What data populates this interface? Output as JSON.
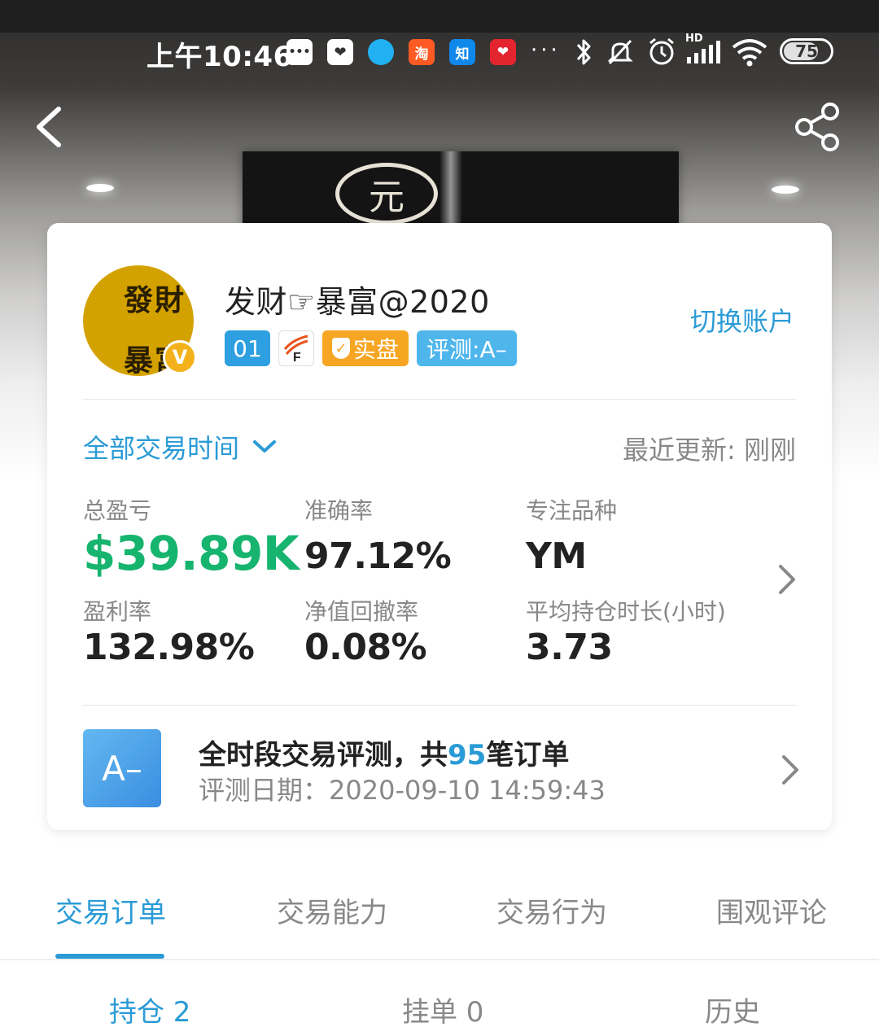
{
  "status_bar": {
    "time": "上午10:46",
    "app_icons": [
      {
        "name": "message-icon",
        "text": "•••",
        "color": "#ffffff"
      },
      {
        "name": "app-heart-icon",
        "text": "❤",
        "color": "#ffffff"
      },
      {
        "name": "app-bird-icon",
        "text": "",
        "color": "#21b1f3"
      },
      {
        "name": "taobao-icon",
        "text": "淘",
        "color": "#ff5a23"
      },
      {
        "name": "zhihu-icon",
        "text": "知",
        "color": "#0f88eb"
      },
      {
        "name": "app-red-heart-icon",
        "text": "❤",
        "color": "#e4252f"
      }
    ],
    "network": "HD",
    "battery": "75",
    "battery_level": 0.75
  },
  "profile": {
    "avatar_line1": "發財",
    "avatar_line2": "暴富",
    "verified_mark": "V",
    "username": "发财☞暴富@2020",
    "badges": {
      "number": "01",
      "f_logo": "F",
      "real_label": "实盘",
      "rating": "评测:A–"
    },
    "switch_account": "切换账户"
  },
  "filter": {
    "period": "全部交易时间",
    "updated": "最近更新: 刚刚"
  },
  "stats": {
    "total_pnl_label": "总盈亏",
    "total_pnl_value": "$39.89K",
    "accuracy_label": "准确率",
    "accuracy_value": "97.12%",
    "focus_label": "专注品种",
    "focus_value": "YM",
    "profit_rate_label": "盈利率",
    "profit_rate_value": "132.98%",
    "drawdown_label": "净值回撤率",
    "drawdown_value": "0.08%",
    "hold_time_label": "平均持仓时长(小时)",
    "hold_time_value": "3.73"
  },
  "evaluation": {
    "grade": "A–",
    "title_prefix": "全时段交易评测，共",
    "order_count": "95",
    "title_suffix": "笔订单",
    "date": "评测日期：2020-09-10 14:59:43"
  },
  "tabs": [
    "交易订单",
    "交易能力",
    "交易行为",
    "围观评论"
  ],
  "subtabs": [
    "持仓 2",
    "挂单 0",
    "历史"
  ],
  "colors": {
    "accent": "#2a9bd6",
    "profit_green": "#16b46e",
    "badge_orange": "#f6a623",
    "avatar_gold": "#d4a200"
  }
}
